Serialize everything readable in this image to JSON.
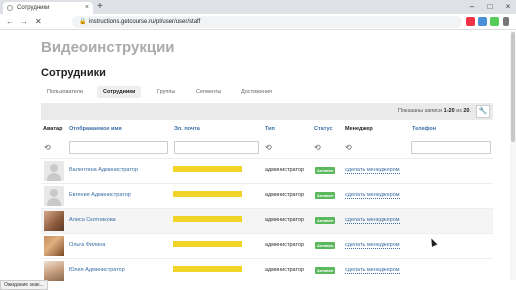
{
  "browser": {
    "tab_title": "Сотрудники",
    "tab_close": "×",
    "new_tab": "+",
    "minimize": "–",
    "maximize": "□",
    "close": "×",
    "back": "←",
    "forward": "→",
    "stop": "✕",
    "url": "instructions.getcourse.ru/pl/user/user/staff",
    "status_text": "Ожидание знак..."
  },
  "page": {
    "heading": "Видеоинструкции",
    "subheading": "Сотрудники",
    "tabs": [
      {
        "label": "Пользователи"
      },
      {
        "label": "Сотрудники"
      },
      {
        "label": "Группы"
      },
      {
        "label": "Сегменты"
      },
      {
        "label": "Достижения"
      }
    ],
    "active_tab": "Сотрудники",
    "shown_prefix": "Показаны записи",
    "shown_range": "1-20",
    "shown_of": "из",
    "shown_total": "20",
    "wrench": "🔧"
  },
  "table": {
    "columns": [
      "Аватар",
      "Отображаемое имя",
      "Эл. почта",
      "Тип",
      "Статус",
      "Менеджер",
      "Телефон"
    ],
    "refresh_icon": "⟲",
    "rows": [
      {
        "name": "Валентина Администратор",
        "type": "администратор",
        "status": "Активен",
        "manager": "сделать менеджером"
      },
      {
        "name": "Евгения Администратор",
        "type": "администратор",
        "status": "Активен",
        "manager": "сделать менеджером"
      },
      {
        "name": "Алиса Скотникова",
        "type": "администратор",
        "status": "Активен",
        "manager": "сделать менеджером"
      },
      {
        "name": "Ольга Филина",
        "type": "администратор",
        "status": "Активен",
        "manager": "сделать менеджером"
      },
      {
        "name": "Юлия Администратор",
        "type": "администратор",
        "status": "Активен",
        "manager": "сделать менеджером"
      }
    ]
  },
  "colors": {
    "accent_link": "#3a6ea5",
    "status_active": "#5cb85c",
    "email_highlight": "#f2d327"
  }
}
